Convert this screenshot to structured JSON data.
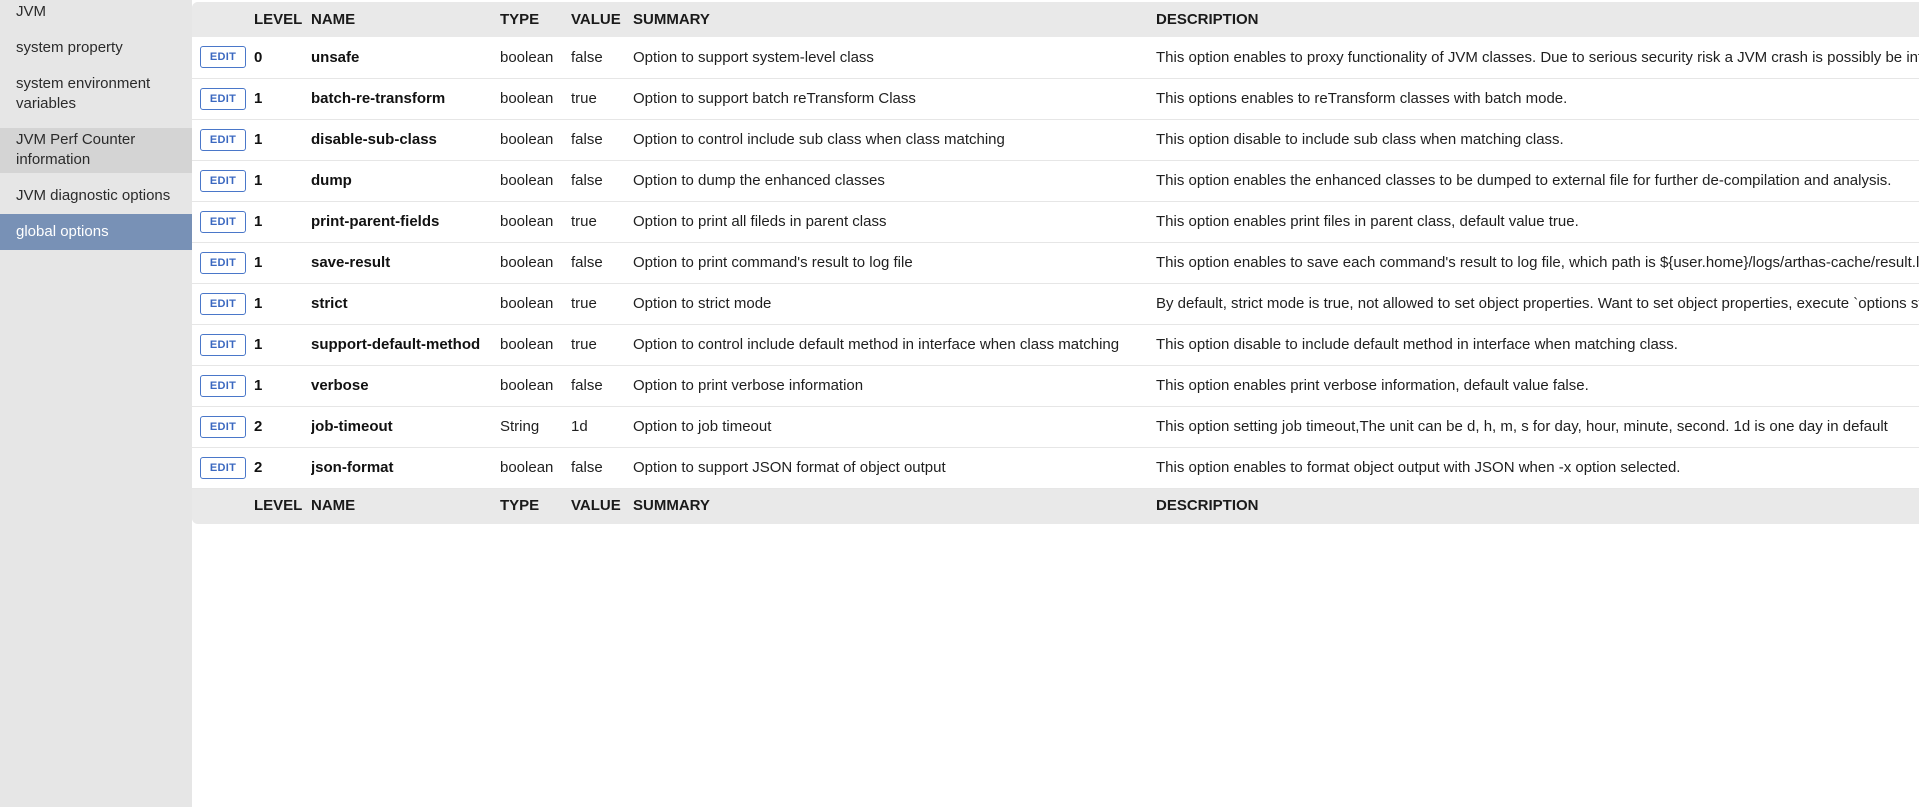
{
  "sidebar": {
    "items": [
      {
        "label": "JVM",
        "state": "normal"
      },
      {
        "label": "system property",
        "state": "normal"
      },
      {
        "label": "system environment variables",
        "state": "normal"
      },
      {
        "label": "JVM Perf Counter information",
        "state": "hover"
      },
      {
        "label": "JVM diagnostic options",
        "state": "normal"
      },
      {
        "label": "global options",
        "state": "active"
      }
    ]
  },
  "table": {
    "headers": {
      "level": "LEVEL",
      "name": "NAME",
      "type": "TYPE",
      "value": "VALUE",
      "summary": "SUMMARY",
      "description": "DESCRIPTION"
    },
    "edit_label": "EDIT",
    "rows": [
      {
        "level": "0",
        "name": "unsafe",
        "type": "boolean",
        "value": "false",
        "summary": "Option to support system-level class",
        "description": "This option enables to proxy functionality of JVM classes. Due to serious security risk a JVM crash is possibly be introduced. Do not activate it unless you are able to manage."
      },
      {
        "level": "1",
        "name": "batch-re-transform",
        "type": "boolean",
        "value": "true",
        "summary": "Option to support batch reTransform Class",
        "description": "This options enables to reTransform classes with batch mode."
      },
      {
        "level": "1",
        "name": "disable-sub-class",
        "type": "boolean",
        "value": "false",
        "summary": "Option to control include sub class when class matching",
        "description": "This option disable to include sub class when matching class."
      },
      {
        "level": "1",
        "name": "dump",
        "type": "boolean",
        "value": "false",
        "summary": "Option to dump the enhanced classes",
        "description": "This option enables the enhanced classes to be dumped to external file for further de-compilation and analysis."
      },
      {
        "level": "1",
        "name": "print-parent-fields",
        "type": "boolean",
        "value": "true",
        "summary": "Option to print all fileds in parent class",
        "description": "This option enables print files in parent class, default value true."
      },
      {
        "level": "1",
        "name": "save-result",
        "type": "boolean",
        "value": "false",
        "summary": "Option to print command's result to log file",
        "description": "This option enables to save each command's result to log file, which path is ${user.home}/logs/arthas-cache/result.log."
      },
      {
        "level": "1",
        "name": "strict",
        "type": "boolean",
        "value": "true",
        "summary": "Option to strict mode",
        "description": "By default, strict mode is true, not allowed to set object properties. Want to set object properties, execute `options strict false`"
      },
      {
        "level": "1",
        "name": "support-default-method",
        "type": "boolean",
        "value": "true",
        "summary": "Option to control include default method in interface when class matching",
        "description": "This option disable to include default method in interface when matching class."
      },
      {
        "level": "1",
        "name": "verbose",
        "type": "boolean",
        "value": "false",
        "summary": "Option to print verbose information",
        "description": "This option enables print verbose information, default value false."
      },
      {
        "level": "2",
        "name": "job-timeout",
        "type": "String",
        "value": "1d",
        "summary": "Option to job timeout",
        "description": "This option setting job timeout,The unit can be d, h, m, s for day, hour, minute, second. 1d is one day in default"
      },
      {
        "level": "2",
        "name": "json-format",
        "type": "boolean",
        "value": "false",
        "summary": "Option to support JSON format of object output",
        "description": "This option enables to format object output with JSON when -x option selected."
      }
    ]
  },
  "colors": {
    "sidebar_bg": "#e6e6e6",
    "sidebar_active": "#7891b6",
    "table_header_bg": "#e9e9e9",
    "edit_button": "#4a77c9"
  }
}
